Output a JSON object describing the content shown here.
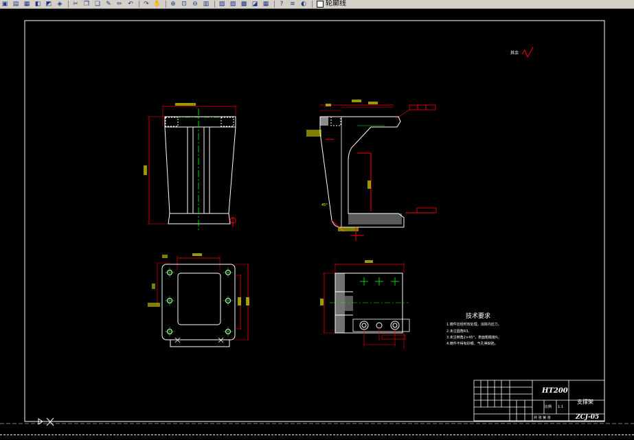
{
  "toolbar": {
    "layer_name": "轮廓线",
    "buttons": [
      "open-icon",
      "save-icon",
      "print-icon",
      "plot-preview-icon",
      "publish-icon",
      "3d-icon",
      "cut-icon",
      "copy-icon",
      "paste-icon",
      "match-prop-icon",
      "pencil-icon",
      "undo-icon",
      "redo-icon",
      "pan-icon",
      "zoom-realtime-icon",
      "zoom-window-icon",
      "zoom-previous-icon",
      "properties-icon",
      "design-center-icon",
      "tool-palette-icon",
      "sheet-set-icon",
      "markup-icon",
      "calc-icon",
      "help-icon",
      "layer-manager-icon",
      "layer-state-icon"
    ]
  },
  "drawing": {
    "roughness_note": "其余",
    "tech_title": "技术要求",
    "tech_items": [
      "1.铸件应经时效处理，消除内应力。",
      "2.未注圆角R3。",
      "3.未注倒角2×45°，表面粗糙度R。",
      "4.铸件不得有砂眼、气孔等缺陷。"
    ],
    "title_block": {
      "material": "HT200",
      "part_name": "支撑架",
      "drawing_no": "ZCJ-05",
      "scale_label": "比例",
      "scale": "1:1",
      "sheet_label": "共 张 第 张"
    }
  }
}
